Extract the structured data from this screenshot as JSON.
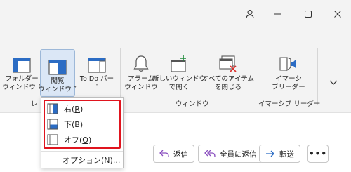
{
  "window": {
    "controls": [
      "account-icon",
      "minimize-icon",
      "maximize-icon",
      "close-icon"
    ]
  },
  "ribbon": {
    "buttons": [
      {
        "id": "folder-pane",
        "line1": "フォルダー",
        "line2": "ウィンドウ ˅",
        "icon": "folder-pane-icon"
      },
      {
        "id": "reading-pane",
        "line1": "閲覧",
        "line2": "ウィンドウ ˅",
        "icon": "reading-pane-icon",
        "pressed": true
      },
      {
        "id": "todo-bar",
        "line1": "To Do バー",
        "line2": "˅",
        "icon": "todo-bar-icon"
      },
      {
        "id": "reminders",
        "line1": "アラーム",
        "line2": "ウィンドウ",
        "icon": "bell-icon"
      },
      {
        "id": "open-new-window",
        "line1": "新しいウィンドウ",
        "line2": "で開く",
        "icon": "new-window-icon"
      },
      {
        "id": "close-all-items",
        "line1": "すべてのアイテム",
        "line2": "を閉じる",
        "icon": "close-all-icon"
      },
      {
        "id": "immersive-reader",
        "line1": "イマーシ",
        "line2": "ブリーダー",
        "icon": "immersive-reader-icon"
      }
    ],
    "groups": {
      "layout": "レ",
      "window": "ウィンドウ",
      "immersive": "イマーシブ リーダー"
    }
  },
  "dropdown": {
    "items": [
      {
        "label": "右(",
        "key": "R",
        "suffix": ")",
        "icon": "pane-right-icon"
      },
      {
        "label": "下(",
        "key": "B",
        "suffix": ")",
        "icon": "pane-bottom-icon"
      },
      {
        "label": "オフ(",
        "key": "O",
        "suffix": ")",
        "icon": "pane-off-icon"
      }
    ],
    "options": {
      "label": "オプション(",
      "key": "N",
      "suffix": ")..."
    },
    "highlight_color": "#e0141e"
  },
  "actions": {
    "reply": "返信",
    "reply_all": "全員に返信",
    "forward": "転送",
    "more": "•••"
  },
  "colors": {
    "accent": "#2b6cc4",
    "reply_icon": "#8a4fbf",
    "forward_icon": "#2b6cc4",
    "close_x": "#d9302c",
    "new_window_plus": "#1e8a3a"
  }
}
